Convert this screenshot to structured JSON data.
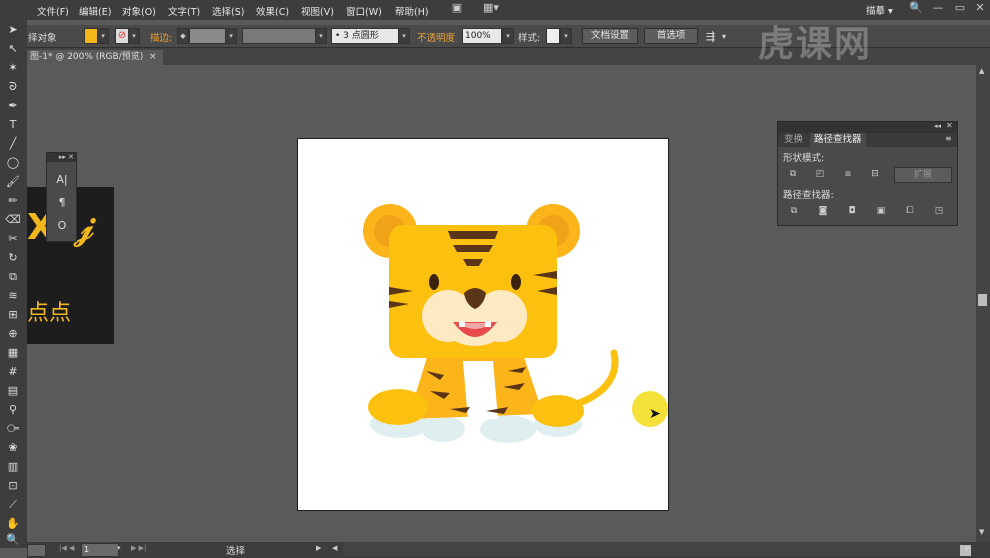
{
  "menu": {
    "items": [
      "文件(F)",
      "编辑(E)",
      "对象(O)",
      "文字(T)",
      "选择(S)",
      "效果(C)",
      "视图(V)",
      "窗口(W)",
      "帮助(H)"
    ],
    "workspace": "描摹 ▾"
  },
  "controlbar": {
    "selection_label": "择对象",
    "stroke_label": "描边:",
    "brush_value": "3 点圆形",
    "opacity_label": "不透明度",
    "opacity_value": "100%",
    "style_label": "样式:",
    "doc_settings": "文档设置",
    "preferences": "首选项"
  },
  "document": {
    "tab_title": "图-1* @ 200% (RGB/预览)",
    "close": "×"
  },
  "glyph_panel": {
    "big_text": "Xx𝒿",
    "small_text": "点点"
  },
  "char_panel": {
    "glyphs": [
      "A|",
      "¶",
      "O"
    ]
  },
  "pathfinder": {
    "tabs": [
      "变换",
      "路径查找器"
    ],
    "shape_modes_label": "形状模式:",
    "expand_label": "扩展",
    "pathfinders_label": "路径查找器:"
  },
  "statusbar": {
    "zoom": "200%",
    "page": "1",
    "tool": "选择"
  },
  "watermark": "虎课网",
  "colors": {
    "tiger_orange": "#fbb41a",
    "tiger_yellow": "#fcc10f",
    "stripe": "#5b3517",
    "muzzle": "#fde9c2",
    "mouth": "#e84a4a",
    "paw_shadow": "#dfeff0",
    "cursor_highlight": "#f6e13a"
  }
}
